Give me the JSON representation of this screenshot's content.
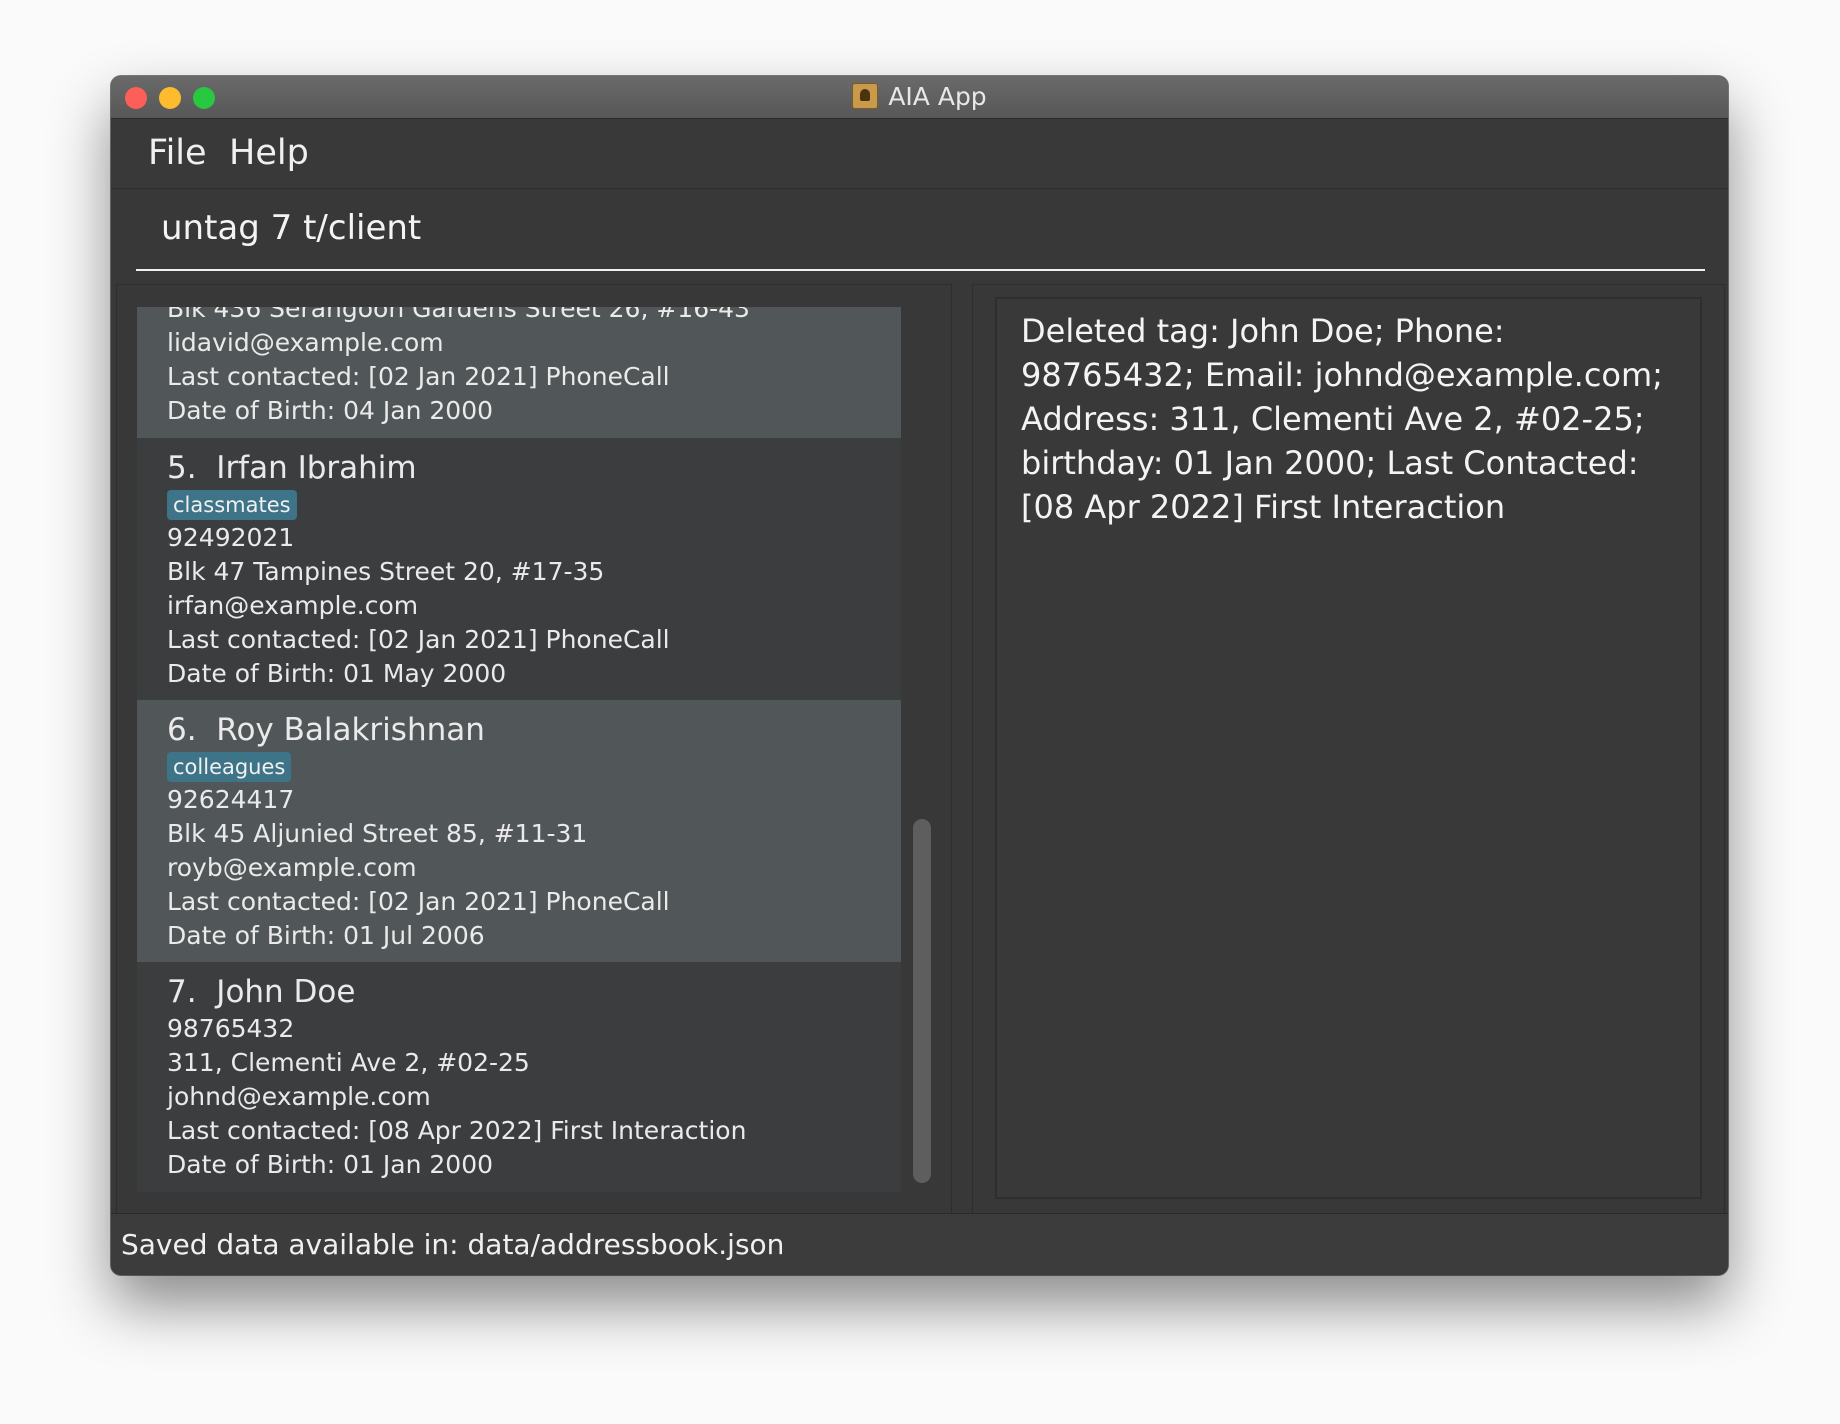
{
  "window": {
    "title": "AIA App",
    "app_icon": "address-book-icon"
  },
  "traffic_lights": {
    "close": "#fc5f57",
    "minimize": "#fdbc2e",
    "maximize": "#28c840"
  },
  "menu": {
    "items": [
      {
        "label": "File"
      },
      {
        "label": "Help"
      }
    ]
  },
  "command": {
    "value": "untag 7 t/client"
  },
  "persons": [
    {
      "partial_top": "Blk 436 Serangoon Gardens Street 26, #16-43",
      "email": "lidavid@example.com",
      "last_contacted": "Last contacted: [02 Jan 2021] PhoneCall",
      "dob": "Date of Birth: 04 Jan 2000"
    },
    {
      "index": "5.",
      "name": "Irfan Ibrahim",
      "tags": [
        "classmates"
      ],
      "phone": "92492021",
      "address": "Blk 47 Tampines Street 20, #17-35",
      "email": "irfan@example.com",
      "last_contacted": "Last contacted: [02 Jan 2021] PhoneCall",
      "dob": "Date of Birth: 01 May 2000"
    },
    {
      "index": "6.",
      "name": "Roy Balakrishnan",
      "tags": [
        "colleagues"
      ],
      "phone": "92624417",
      "address": "Blk 45 Aljunied Street 85, #11-31",
      "email": "royb@example.com",
      "last_contacted": "Last contacted: [02 Jan 2021] PhoneCall",
      "dob": "Date of Birth: 01 Jul 2006"
    },
    {
      "index": "7.",
      "name": "John Doe",
      "tags": [],
      "phone": "98765432",
      "address": "311, Clementi Ave 2, #02-25",
      "email": "johnd@example.com",
      "last_contacted": "Last contacted: [08 Apr 2022] First Interaction",
      "dob": "Date of Birth: 01 Jan 2000"
    }
  ],
  "result": {
    "text": "Deleted tag: John Doe; Phone: 98765432; Email: johnd@example.com; Address: 311, Clementi Ave 2, #02-25; birthday: 01 Jan 2000; Last Contacted: [08 Apr 2022] First Interaction"
  },
  "status": {
    "text": "Saved data available in: data/addressbook.json"
  },
  "colors": {
    "background": "#383838",
    "selected_cell": "#515658",
    "cell": "#3c3d3f",
    "tag": "#3e7488"
  }
}
